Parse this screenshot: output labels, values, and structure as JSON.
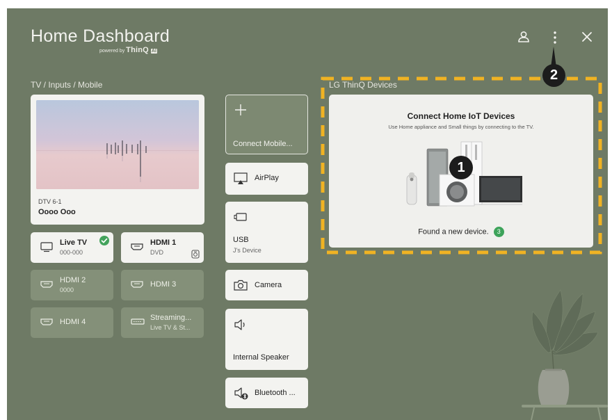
{
  "header": {
    "title": "Home Dashboard",
    "powered_by": "powered by",
    "brand": "ThinQ",
    "brand_badge": "AI"
  },
  "section": {
    "tv_inputs_title": "TV / Inputs / Mobile"
  },
  "tv": {
    "channel": "DTV 6-1",
    "program": "Oooo Ooo"
  },
  "inputs": [
    {
      "name": "Live TV",
      "sub": "000-000",
      "selected": true
    },
    {
      "name": "HDMI 1",
      "sub": "DVD"
    },
    {
      "name": "HDMI 2",
      "sub": "0000"
    },
    {
      "name": "HDMI 3",
      "sub": ""
    },
    {
      "name": "HDMI 4",
      "sub": ""
    },
    {
      "name": "Streaming...",
      "sub": "Live TV & St..."
    }
  ],
  "mobile": {
    "connect_label": "Connect Mobile...",
    "airplay": "AirPlay",
    "usb_title": "USB",
    "usb_device": "J's Device",
    "camera": "Camera",
    "internal_speaker": "Internal Speaker",
    "bluetooth": "Bluetooth ..."
  },
  "thinq": {
    "section_title": "LG ThinQ Devices",
    "card_title": "Connect Home IoT Devices",
    "card_desc": "Use Home appliance and Small things by connecting to the TV.",
    "found_text": "Found a new device.",
    "found_count": "3"
  },
  "markers": {
    "one": "1",
    "two": "2"
  },
  "colors": {
    "background": "#6e7a65",
    "dashed_highlight": "#f0b323",
    "check_green": "#43a35c",
    "count_green": "#3da35a",
    "card_white": "#f3f3f0"
  }
}
